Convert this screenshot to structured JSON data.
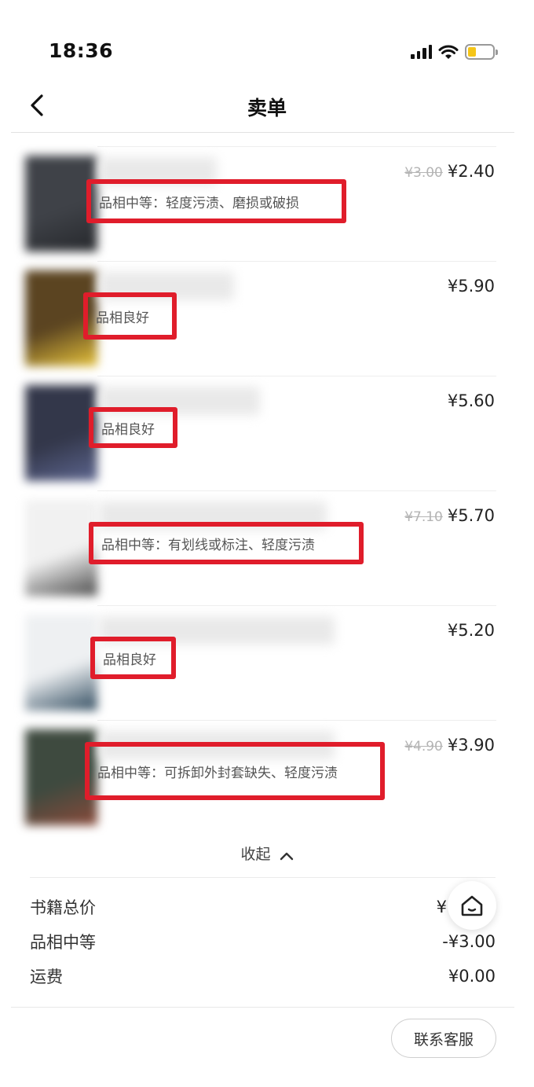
{
  "status_bar": {
    "time": "18:36"
  },
  "nav": {
    "title": "卖单"
  },
  "books": [
    {
      "old_price": "¥3.00",
      "price": "¥2.40",
      "condition": "品相中等：轻度污渍、磨损或破损",
      "cover_color": "#3f4248",
      "cover_accent": "#26282c"
    },
    {
      "old_price": "",
      "price": "¥5.90",
      "condition": "品相良好",
      "cover_color": "#5b4421",
      "cover_accent": "#e6c23a"
    },
    {
      "old_price": "",
      "price": "¥5.60",
      "condition": "品相良好",
      "cover_color": "#33374a",
      "cover_accent": "#5d6690"
    },
    {
      "old_price": "¥7.10",
      "price": "¥5.70",
      "condition": "品相中等：有划线或标注、轻度污渍",
      "cover_color": "#f1f1f1",
      "cover_accent": "#4a4a4a"
    },
    {
      "old_price": "",
      "price": "¥5.20",
      "condition": "品相良好",
      "cover_color": "#eef0f2",
      "cover_accent": "#2f4a5e"
    },
    {
      "old_price": "¥4.90",
      "price": "¥3.90",
      "condition": "品相中等：可拆卸外封套缺失、轻度污渍",
      "cover_color": "#3e4a3f",
      "cover_accent": "#8a4a3a"
    }
  ],
  "collapse": {
    "label": "收起"
  },
  "summary": {
    "total_label": "书籍总价",
    "total_value": "¥",
    "condition_label": "品相中等",
    "condition_value": "-¥3.00",
    "shipping_label": "运费",
    "shipping_value": "¥0.00"
  },
  "footer": {
    "service_label": "联系客服"
  },
  "colors": {
    "highlight_box": "#e01d2b"
  }
}
